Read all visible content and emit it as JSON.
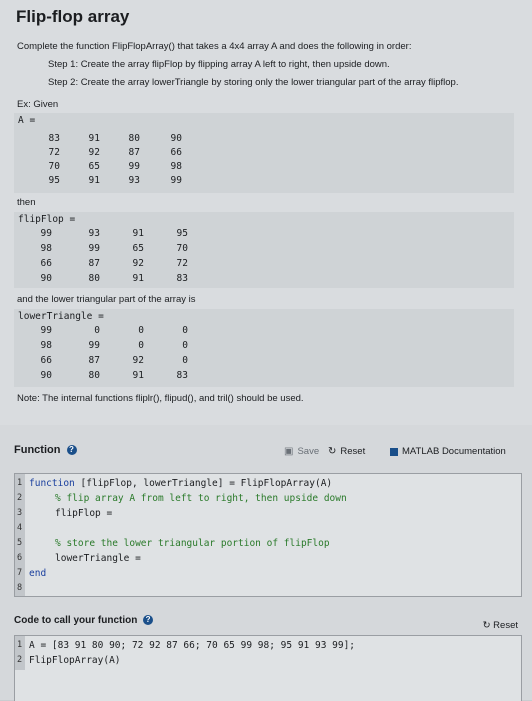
{
  "problem": {
    "title": "Flip-flop array",
    "intro": "Complete the function FlipFlopArray() that takes a 4x4 array A and does the following in order:",
    "step1": "Step 1: Create the array flipFlop by flipping array A left to right, then upside down.",
    "step2": "Step 2: Create the array lowerTriangle by storing only the lower triangular part of the array flipflop.",
    "ex_label": "Ex: Given",
    "A_label": "A =",
    "A": [
      [
        "83",
        "91",
        "80",
        "90"
      ],
      [
        "72",
        "92",
        "87",
        "66"
      ],
      [
        "70",
        "65",
        "99",
        "98"
      ],
      [
        "95",
        "91",
        "93",
        "99"
      ]
    ],
    "then": "then",
    "flipflop_label": "flipFlop =",
    "flipflop": [
      [
        "99",
        "93",
        "91",
        "95"
      ],
      [
        "98",
        "99",
        "65",
        "70"
      ],
      [
        "66",
        "87",
        "92",
        "72"
      ],
      [
        "90",
        "80",
        "91",
        "83"
      ]
    ],
    "lower_text": "and the lower triangular part of the array is",
    "lower_label": "lowerTriangle =",
    "lower": [
      [
        "99",
        "0",
        "0",
        "0"
      ],
      [
        "98",
        "99",
        "0",
        "0"
      ],
      [
        "66",
        "87",
        "92",
        "0"
      ],
      [
        "90",
        "80",
        "91",
        "83"
      ]
    ],
    "note": "Note: The internal functions fliplr(), flipud(), and tril() should be used."
  },
  "function_section": {
    "title": "Function",
    "save_label": "Save",
    "reset_label": "Reset",
    "docs_label": "MATLAB Documentation",
    "line_numbers": [
      "1",
      "2",
      "3",
      "4",
      "5",
      "6",
      "7",
      "8"
    ],
    "code": {
      "l1_kw": "function",
      "l1_rest": " [flipFlop, lowerTriangle] = FlipFlopArray(A)",
      "l2": "% flip array A from left to right, then upside down",
      "l3": "flipFlop =",
      "l5": "% store the lower triangular portion of flipFlop",
      "l6": "lowerTriangle =",
      "l7": "end"
    }
  },
  "call_section": {
    "title": "Code to call your function",
    "reset_label": "Reset",
    "line_numbers": [
      "1",
      "2"
    ],
    "line1": "A = [83 91 80 90; 72 92 87 66; 70 65 99 98; 95 91 93 99];",
    "line2": "FlipFlopArray(A)"
  },
  "colors": {
    "accent": "#1a4f8a",
    "keyword": "#1a3f9e",
    "comment": "#2a7a2a"
  },
  "icons": [
    "help-icon",
    "save-icon",
    "reset-icon",
    "docs-icon"
  ]
}
